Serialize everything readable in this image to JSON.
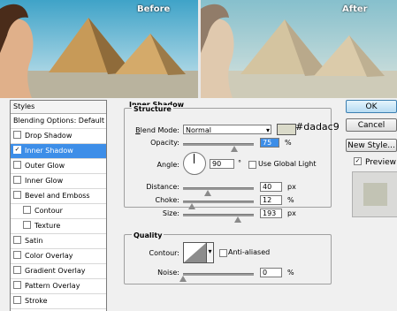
{
  "images": {
    "before_label": "Before",
    "after_label": "After"
  },
  "styles_panel": {
    "header": "Styles",
    "items": [
      {
        "label": "Blending Options: Default",
        "checkbox": false,
        "checked": false,
        "selected": false,
        "sub": false
      },
      {
        "label": "Drop Shadow",
        "checkbox": true,
        "checked": false,
        "selected": false,
        "sub": false
      },
      {
        "label": "Inner Shadow",
        "checkbox": true,
        "checked": true,
        "selected": true,
        "sub": false
      },
      {
        "label": "Outer Glow",
        "checkbox": true,
        "checked": false,
        "selected": false,
        "sub": false
      },
      {
        "label": "Inner Glow",
        "checkbox": true,
        "checked": false,
        "selected": false,
        "sub": false
      },
      {
        "label": "Bevel and Emboss",
        "checkbox": true,
        "checked": false,
        "selected": false,
        "sub": false
      },
      {
        "label": "Contour",
        "checkbox": true,
        "checked": false,
        "selected": false,
        "sub": true
      },
      {
        "label": "Texture",
        "checkbox": true,
        "checked": false,
        "selected": false,
        "sub": true
      },
      {
        "label": "Satin",
        "checkbox": true,
        "checked": false,
        "selected": false,
        "sub": false
      },
      {
        "label": "Color Overlay",
        "checkbox": true,
        "checked": false,
        "selected": false,
        "sub": false
      },
      {
        "label": "Gradient Overlay",
        "checkbox": true,
        "checked": false,
        "selected": false,
        "sub": false
      },
      {
        "label": "Pattern Overlay",
        "checkbox": true,
        "checked": false,
        "selected": false,
        "sub": false
      },
      {
        "label": "Stroke",
        "checkbox": true,
        "checked": false,
        "selected": false,
        "sub": false
      }
    ]
  },
  "inner_shadow": {
    "title": "Inner Shadow",
    "structure": {
      "title": "Structure",
      "blend_mode_label": "Blend Mode:",
      "blend_mode_value": "Normal",
      "color_hex": "#dadac9",
      "opacity_label": "Opacity:",
      "opacity_value": "75",
      "opacity_unit": "%",
      "angle_label": "Angle:",
      "angle_value": "90",
      "angle_unit": "°",
      "use_global_light_label": "Use Global Light",
      "use_global_light_checked": false,
      "distance_label": "Distance:",
      "distance_value": "40",
      "distance_unit": "px",
      "choke_label": "Choke:",
      "choke_value": "12",
      "choke_unit": "%",
      "size_label": "Size:",
      "size_value": "193",
      "size_unit": "px"
    },
    "quality": {
      "title": "Quality",
      "contour_label": "Contour:",
      "anti_aliased_label": "Anti-aliased",
      "anti_aliased_checked": false,
      "noise_label": "Noise:",
      "noise_value": "0",
      "noise_unit": "%"
    }
  },
  "buttons": {
    "ok": "OK",
    "cancel": "Cancel",
    "new_style": "New Style...",
    "preview_label": "Preview",
    "preview_checked": true
  },
  "colors": {
    "selection": "#3d8ee8",
    "shadow_color": "#dadac9",
    "preview_swatch": "#c2c3b4"
  }
}
